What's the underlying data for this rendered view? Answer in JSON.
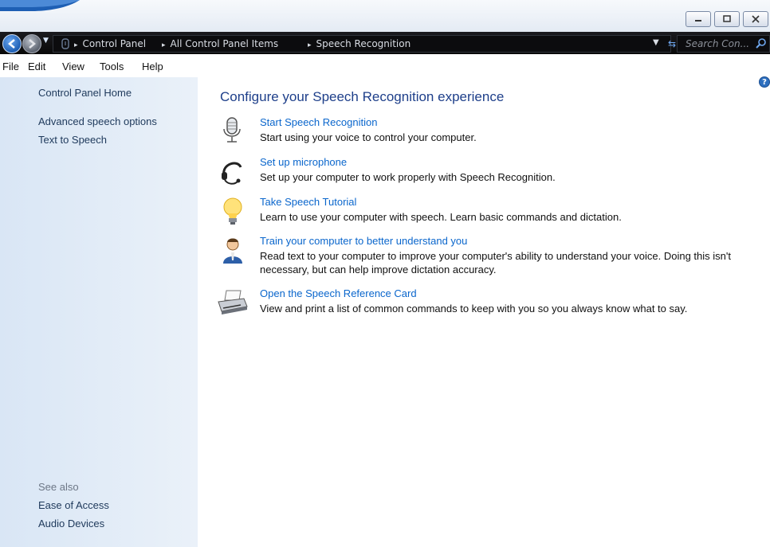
{
  "window": {
    "buttons": [
      {
        "name": "minimize",
        "glyph": "–"
      },
      {
        "name": "maximize",
        "glyph": "▫"
      },
      {
        "name": "close",
        "glyph": "✕"
      }
    ]
  },
  "address": {
    "breadcrumbs": [
      "Control Panel",
      "All Control Panel Items",
      "Speech Recognition"
    ],
    "separator": "▸",
    "search_placeholder": "Search Con..."
  },
  "menu": [
    "File",
    "Edit",
    "View",
    "Tools",
    "Help"
  ],
  "sidebar": {
    "home": "Control Panel Home",
    "links": [
      "Advanced speech options",
      "Text to Speech"
    ],
    "see_also_label": "See also",
    "see_also": [
      "Ease of Access",
      "Audio Devices"
    ]
  },
  "main": {
    "title": "Configure your Speech Recognition experience",
    "tasks": [
      {
        "icon": "microphone-icon",
        "link": "Start Speech Recognition",
        "desc": "Start using your voice to control your computer."
      },
      {
        "icon": "headset-icon",
        "link": "Set up microphone",
        "desc": "Set up your computer to work properly with Speech Recognition."
      },
      {
        "icon": "lightbulb-icon",
        "link": "Take Speech Tutorial",
        "desc": "Learn to use your computer with speech.  Learn basic commands and dictation."
      },
      {
        "icon": "user-training-icon",
        "link": "Train your computer to better understand you",
        "desc": "Read text to your computer to improve your computer's ability to understand your voice.  Doing this isn't necessary, but can help improve dictation accuracy."
      },
      {
        "icon": "printer-icon",
        "link": "Open the Speech Reference Card",
        "desc": "View and print a list of common commands to keep with you so you always know what to say."
      }
    ]
  },
  "help": "?",
  "colors": {
    "link": "#0a66cc",
    "title": "#1e3f8a",
    "sidebar_bg": "#dde8f5",
    "addressbar_bg": "#111114"
  }
}
